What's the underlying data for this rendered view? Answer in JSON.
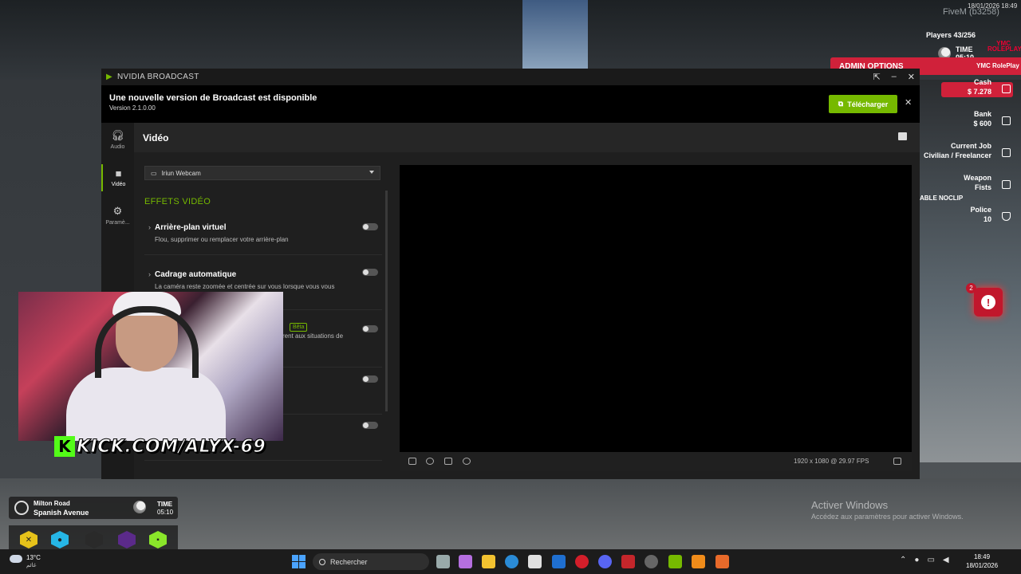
{
  "overlay": {
    "fivem_tag": "FiveM (b3258)",
    "top_date": "18/01/2026 18:49"
  },
  "hud": {
    "players": "Players 43/256",
    "logo_text": "YMC ROLEPLAY",
    "time_label": "TIME",
    "time_value": "05:10",
    "admin_options": "ADMIN OPTIONS",
    "admin_sub": "YMC RolePlay",
    "cash_label": "Cash",
    "cash_value": "$ 7.278",
    "bank_label": "Bank",
    "bank_value": "$ 600",
    "job_label": "Current Job",
    "job_value": "Civilian / Freelancer",
    "weapon_label": "Weapon",
    "weapon_value": "Fists",
    "police_label": "Police",
    "police_value": "10",
    "noclip_text": "ABLE NOCLIP",
    "notif_count": "2",
    "notif_symbol": "!",
    "accent": "#d0213a"
  },
  "broadcast": {
    "window_title": "NVIDIA BROADCAST",
    "update_title": "Une nouvelle version de Broadcast est disponible",
    "update_version": "Version 2.1.0.00",
    "download_label": "Télécharger",
    "sidebar": [
      {
        "label": "Audio",
        "icon": "headphones-icon"
      },
      {
        "label": "Vidéo",
        "icon": "camera-icon"
      },
      {
        "label": "Paramè...",
        "icon": "gear-icon"
      }
    ],
    "page_title": "Vidéo",
    "camera_source": "Iriun Webcam",
    "effects_title": "EFFETS VIDÉO",
    "effects": [
      {
        "name": "Arrière-plan virtuel",
        "desc": "Flou, supprimer ou remplacer votre arrière-plan",
        "enabled": false
      },
      {
        "name": "Cadrage automatique",
        "desc": "La caméra reste zoomée et centrée sur vous lorsque vous vous",
        "enabled": false
      },
      {
        "name": "",
        "desc": "rent aux situations de",
        "enabled": false,
        "badge": "Bêta"
      },
      {
        "name": "",
        "desc": "",
        "enabled": false
      },
      {
        "name": "",
        "desc": "age",
        "enabled": false
      }
    ],
    "fps_info": "1920 x 1080 @ 29.97 FPS",
    "brand_color": "#76b900"
  },
  "webcam": {
    "kick_label": "KICK.COM/ALYX-69",
    "kick_logo": "K"
  },
  "location": {
    "street": "Milton Road",
    "area": "Spanish Avenue",
    "time_label": "TIME",
    "time_value": "05:10"
  },
  "watermark": {
    "title": "Activer Windows",
    "subtitle": "Accédez aux paramètres pour activer Windows."
  },
  "taskbar": {
    "temp": "13°C",
    "weather_label": "غائم",
    "search_placeholder": "Rechercher",
    "time": "18:49",
    "date": "18/01/2026"
  }
}
